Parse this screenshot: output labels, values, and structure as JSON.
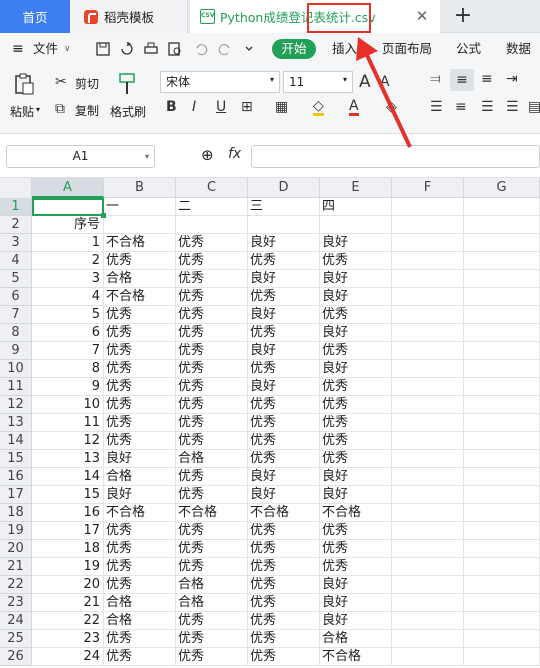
{
  "tabs": {
    "home": "首页",
    "template": "稻壳模板",
    "file": "Python成绩登记表统计.csv",
    "add": "+",
    "close": "✕"
  },
  "menu": {
    "file": "文件",
    "start": "开始",
    "insert": "插入",
    "layout": "页面布局",
    "formula": "公式",
    "data": "数据"
  },
  "ribbon": {
    "paste": "粘贴",
    "cut": "剪切",
    "copy": "复制",
    "format_painter": "格式刷",
    "font_name": "宋体",
    "font_size": "11"
  },
  "formula_bar": {
    "cell_ref": "A1",
    "fx": "fx"
  },
  "columns": [
    "A",
    "B",
    "C",
    "D",
    "E",
    "F",
    "G"
  ],
  "row_numbers": [
    "1",
    "2",
    "3",
    "4",
    "5",
    "6",
    "7",
    "8",
    "9",
    "10",
    "11",
    "12",
    "13",
    "14",
    "15",
    "16",
    "17",
    "18",
    "19",
    "20",
    "21",
    "22",
    "23",
    "24",
    "25",
    "26"
  ],
  "cells": [
    [
      "",
      "一",
      "二",
      "三",
      "四"
    ],
    [
      "序号",
      "",
      "",
      "",
      ""
    ],
    [
      "1",
      "不合格",
      "优秀",
      "良好",
      "良好"
    ],
    [
      "2",
      "优秀",
      "优秀",
      "优秀",
      "优秀"
    ],
    [
      "3",
      "合格",
      "优秀",
      "良好",
      "良好"
    ],
    [
      "4",
      "不合格",
      "优秀",
      "优秀",
      "良好"
    ],
    [
      "5",
      "优秀",
      "优秀",
      "良好",
      "优秀"
    ],
    [
      "6",
      "优秀",
      "优秀",
      "优秀",
      "良好"
    ],
    [
      "7",
      "优秀",
      "优秀",
      "良好",
      "优秀"
    ],
    [
      "8",
      "优秀",
      "优秀",
      "优秀",
      "良好"
    ],
    [
      "9",
      "优秀",
      "优秀",
      "良好",
      "优秀"
    ],
    [
      "10",
      "优秀",
      "优秀",
      "优秀",
      "优秀"
    ],
    [
      "11",
      "优秀",
      "优秀",
      "优秀",
      "优秀"
    ],
    [
      "12",
      "优秀",
      "优秀",
      "优秀",
      "优秀"
    ],
    [
      "13",
      "良好",
      "合格",
      "优秀",
      "优秀"
    ],
    [
      "14",
      "合格",
      "优秀",
      "良好",
      "良好"
    ],
    [
      "15",
      "良好",
      "优秀",
      "良好",
      "良好"
    ],
    [
      "16",
      "不合格",
      "不合格",
      "不合格",
      "不合格"
    ],
    [
      "17",
      "优秀",
      "优秀",
      "优秀",
      "优秀"
    ],
    [
      "18",
      "优秀",
      "优秀",
      "优秀",
      "优秀"
    ],
    [
      "19",
      "优秀",
      "优秀",
      "优秀",
      "优秀"
    ],
    [
      "20",
      "优秀",
      "合格",
      "优秀",
      "良好"
    ],
    [
      "21",
      "合格",
      "合格",
      "优秀",
      "良好"
    ],
    [
      "22",
      "合格",
      "优秀",
      "优秀",
      "良好"
    ],
    [
      "23",
      "优秀",
      "优秀",
      "优秀",
      "合格"
    ],
    [
      "24",
      "优秀",
      "优秀",
      "优秀",
      "不合格"
    ]
  ],
  "colors": {
    "accent_green": "#23a057",
    "home_tab_blue": "#3d7ff0",
    "annotation_red": "#e8302a"
  }
}
